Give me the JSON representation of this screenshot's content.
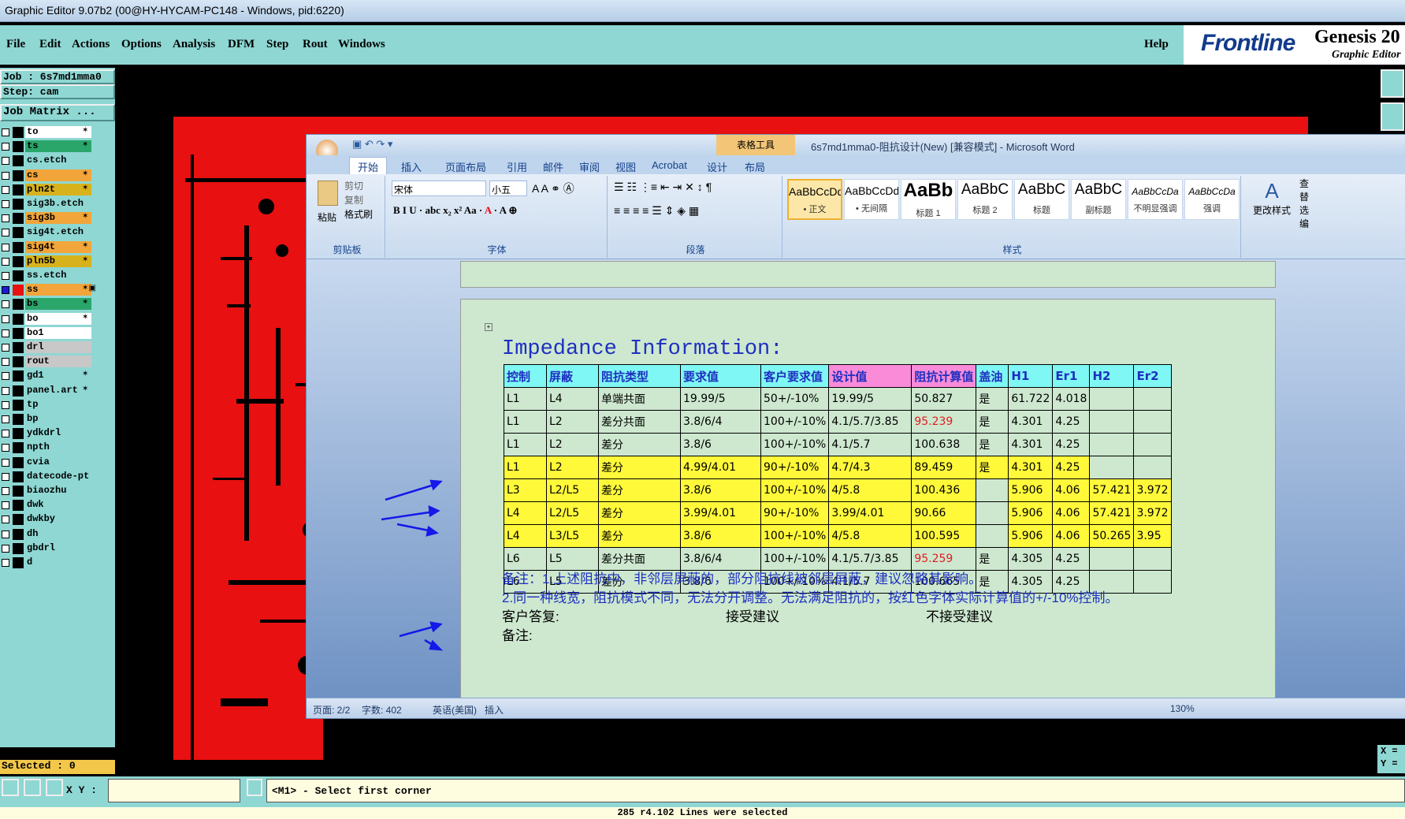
{
  "window_title": "Graphic Editor 9.07b2 (00@HY-HYCAM-PC148 - Windows, pid:6220)",
  "menu": [
    "File",
    "Edit",
    "Actions",
    "Options",
    "Analysis",
    "DFM",
    "Step",
    "Rout",
    "Windows"
  ],
  "help": "Help",
  "brand": {
    "logo": "Frontline",
    "product": "Genesis 20",
    "subtitle": "Graphic Editor"
  },
  "job": "Job : 6s7md1mma0",
  "step": "Step: cam",
  "job_matrix": "Job Matrix ...",
  "layers": [
    {
      "name": "to",
      "color": "#ffffff",
      "mark": "✶"
    },
    {
      "name": "ts",
      "color": "#2aa66b",
      "mark": "✶"
    },
    {
      "name": "cs.etch",
      "color": "#8ed7d3",
      "mark": ""
    },
    {
      "name": "cs",
      "color": "#f2a53a",
      "mark": "✶"
    },
    {
      "name": "pln2t",
      "color": "#d7b21c",
      "mark": "✶"
    },
    {
      "name": "sig3b.etch",
      "color": "#8ed7d3",
      "mark": ""
    },
    {
      "name": "sig3b",
      "color": "#f2a53a",
      "mark": "✶"
    },
    {
      "name": "sig4t.etch",
      "color": "#8ed7d3",
      "mark": ""
    },
    {
      "name": "sig4t",
      "color": "#f2a53a",
      "mark": "✶"
    },
    {
      "name": "pln5b",
      "color": "#d7b21c",
      "mark": "✶"
    },
    {
      "name": "ss.etch",
      "color": "#8ed7d3",
      "mark": ""
    },
    {
      "name": "ss",
      "color": "#f2a53a",
      "mark": "✶▣"
    },
    {
      "name": "bs",
      "color": "#2aa66b",
      "mark": "✶"
    },
    {
      "name": "bo",
      "color": "#ffffff",
      "mark": "✶"
    },
    {
      "name": "bo1",
      "color": "#ffffff",
      "mark": ""
    },
    {
      "name": "drl",
      "color": "#c8c8c8",
      "mark": ""
    },
    {
      "name": "rout",
      "color": "#c8c8c8",
      "mark": ""
    },
    {
      "name": "gd1",
      "color": "#8ed7d3",
      "mark": "✶"
    },
    {
      "name": "panel.art",
      "color": "#8ed7d3",
      "mark": "✶"
    },
    {
      "name": "tp",
      "color": "#8ed7d3",
      "mark": ""
    },
    {
      "name": "bp",
      "color": "#8ed7d3",
      "mark": ""
    },
    {
      "name": "ydkdrl",
      "color": "#8ed7d3",
      "mark": ""
    },
    {
      "name": "npth",
      "color": "#8ed7d3",
      "mark": ""
    },
    {
      "name": "cvia",
      "color": "#8ed7d3",
      "mark": ""
    },
    {
      "name": "datecode-pt",
      "color": "#8ed7d3",
      "mark": ""
    },
    {
      "name": "biaozhu",
      "color": "#8ed7d3",
      "mark": ""
    },
    {
      "name": "dwk",
      "color": "#8ed7d3",
      "mark": ""
    },
    {
      "name": "dwkby",
      "color": "#8ed7d3",
      "mark": ""
    },
    {
      "name": "dh",
      "color": "#8ed7d3",
      "mark": ""
    },
    {
      "name": "gbdrl",
      "color": "#8ed7d3",
      "mark": ""
    },
    {
      "name": "d",
      "color": "#8ed7d3",
      "mark": ""
    }
  ],
  "selected": "Selected : 0",
  "xy_label": "X Y :",
  "xy_value": "",
  "prompt": "<M1> - Select first corner",
  "status_line": "285 r4.102 Lines were selected",
  "xy_readout": {
    "x": "X =",
    "y": "Y ="
  },
  "word": {
    "title": "6s7md1mma0-阻抗设计(New) [兼容模式] - Microsoft Word",
    "table_tools": "表格工具",
    "tabs": [
      "开始",
      "插入",
      "页面布局",
      "引用",
      "邮件",
      "审阅",
      "视图",
      "Acrobat",
      "设计",
      "布局"
    ],
    "clipboard": {
      "paste": "粘贴",
      "cut": "剪切",
      "copy": "复制",
      "format_painter": "格式刷",
      "label": "剪贴板"
    },
    "font": {
      "name": "宋体",
      "size": "小五",
      "label": "字体"
    },
    "paragraph_label": "段落",
    "styles_label": "样式",
    "change_styles": "更改样式",
    "styles": [
      {
        "preview": "AaBbCcDd",
        "name": "• 正文"
      },
      {
        "preview": "AaBbCcDd",
        "name": "• 无间隔"
      },
      {
        "preview": "AaBb",
        "name": "标题 1"
      },
      {
        "preview": "AaBbC",
        "name": "标题 2"
      },
      {
        "preview": "AaBbC",
        "name": "标题"
      },
      {
        "preview": "AaBbC",
        "name": "副标题"
      },
      {
        "preview": "AaBbCcDa",
        "name": "不明显强调"
      },
      {
        "preview": "AaBbCcDa",
        "name": "强调"
      }
    ],
    "edit_side": [
      "查",
      "替",
      "选",
      "编"
    ],
    "doc_title": "Impedance Information:",
    "table_header": [
      "控制",
      "屏蔽",
      "阻抗类型",
      "要求值",
      "客户要求值",
      "设计值",
      "阻抗计算值",
      "盖油",
      "H1",
      "Er1",
      "H2",
      "Er2"
    ],
    "table_rows": [
      {
        "hl": false,
        "cells": [
          "L1",
          "L4",
          "单端共面",
          "19.99/5",
          "50+/-10%",
          "19.99/5",
          "50.827",
          "是",
          "61.722",
          "4.018",
          "",
          ""
        ],
        "red": false
      },
      {
        "hl": false,
        "cells": [
          "L1",
          "L2",
          "差分共面",
          "3.8/6/4",
          "100+/-10%",
          "4.1/5.7/3.85",
          "95.239",
          "是",
          "4.301",
          "4.25",
          "",
          ""
        ],
        "red": true
      },
      {
        "hl": false,
        "cells": [
          "L1",
          "L2",
          "差分",
          "3.8/6",
          "100+/-10%",
          "4.1/5.7",
          "100.638",
          "是",
          "4.301",
          "4.25",
          "",
          ""
        ],
        "red": false
      },
      {
        "hl": true,
        "cells": [
          "L1",
          "L2",
          "差分",
          "4.99/4.01",
          "90+/-10%",
          "4.7/4.3",
          "89.459",
          "是",
          "4.301",
          "4.25",
          "",
          ""
        ],
        "red": false
      },
      {
        "hl": true,
        "cells": [
          "L3",
          "L2/L5",
          "差分",
          "3.8/6",
          "100+/-10%",
          "4/5.8",
          "100.436",
          "",
          "5.906",
          "4.06",
          "57.421",
          "3.972"
        ],
        "red": false
      },
      {
        "hl": true,
        "cells": [
          "L4",
          "L2/L5",
          "差分",
          "3.99/4.01",
          "90+/-10%",
          "3.99/4.01",
          "90.66",
          "",
          "5.906",
          "4.06",
          "57.421",
          "3.972"
        ],
        "red": false
      },
      {
        "hl": true,
        "cells": [
          "L4",
          "L3/L5",
          "差分",
          "3.8/6",
          "100+/-10%",
          "4/5.8",
          "100.595",
          "",
          "5.906",
          "4.06",
          "50.265",
          "3.95"
        ],
        "red": false
      },
      {
        "hl": false,
        "cells": [
          "L6",
          "L5",
          "差分共面",
          "3.8/6/4",
          "100+/-10%",
          "4.1/5.7/3.85",
          "95.259",
          "是",
          "4.305",
          "4.25",
          "",
          ""
        ],
        "red": true
      },
      {
        "hl": false,
        "cells": [
          "L6",
          "L5",
          "差分",
          "3.8/6",
          "100+/-10%",
          "4.1/5.7",
          "100.665",
          "是",
          "4.305",
          "4.25",
          "",
          ""
        ],
        "red": false
      }
    ],
    "note1": "备注：1.上述阻抗中，非邻层屏蔽的，部分阻抗线被邻层屏蔽，建议忽略其影响。",
    "note2": "2.同一种线宽，阻抗模式不同，无法分开调整。无法满足阻抗的，按红色字体实际计算值的+/-10%控制。",
    "reply_label": "客户答复:",
    "accept": "接受建议",
    "reject": "不接受建议",
    "remark": "备注:",
    "status": {
      "page": "页面: 2/2",
      "words": "字数: 402",
      "lang": "英语(美国)",
      "insert": "插入",
      "zoom": "130%"
    }
  }
}
